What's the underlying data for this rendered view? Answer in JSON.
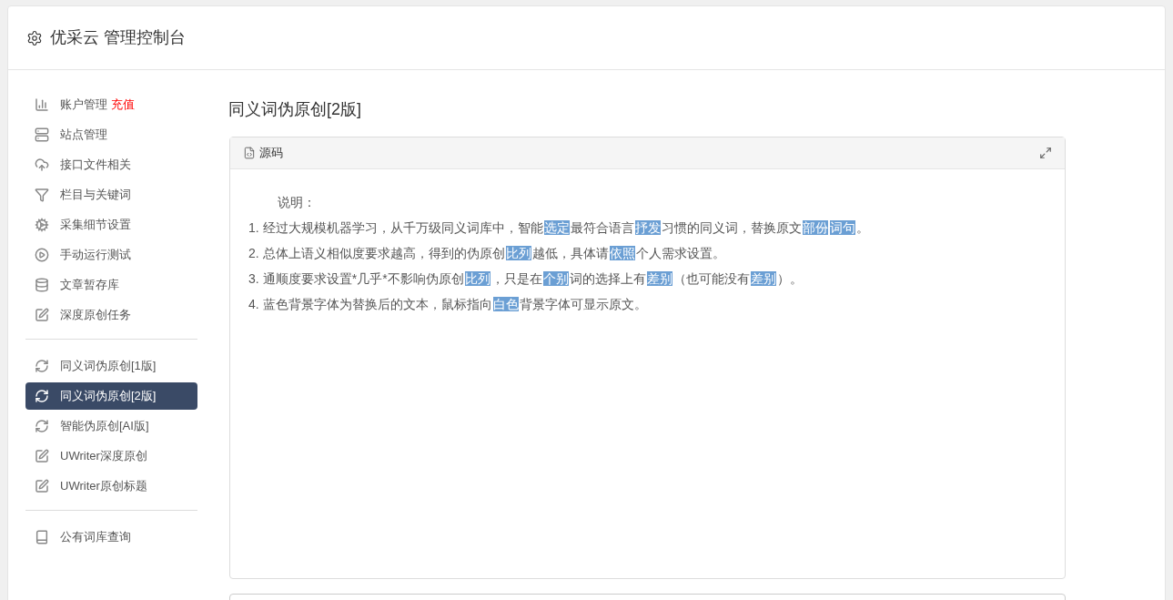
{
  "header": {
    "title": "优采云 管理控制台"
  },
  "sidebar": {
    "groups": [
      {
        "items": [
          {
            "label": "账户管理",
            "badge": "充值",
            "selected": false
          },
          {
            "label": "站点管理",
            "selected": false
          },
          {
            "label": "接口文件相关",
            "selected": false
          },
          {
            "label": "栏目与关键词",
            "selected": false
          },
          {
            "label": "采集细节设置",
            "selected": false
          },
          {
            "label": "手动运行测试",
            "selected": false
          },
          {
            "label": "文章暂存库",
            "selected": false
          },
          {
            "label": "深度原创任务",
            "selected": false
          }
        ]
      },
      {
        "items": [
          {
            "label": "同义词伪原创[1版]",
            "selected": false
          },
          {
            "label": "同义词伪原创[2版]",
            "selected": true
          },
          {
            "label": "智能伪原创[AI版]",
            "selected": false
          },
          {
            "label": "UWriter深度原创",
            "selected": false
          },
          {
            "label": "UWriter原创标题",
            "selected": false
          }
        ]
      },
      {
        "items": [
          {
            "label": "公有词库查询",
            "selected": false
          }
        ]
      }
    ]
  },
  "page": {
    "title": "同义词伪原创[2版]",
    "panel": {
      "tab": "源码",
      "heading": "说明：",
      "lines": [
        {
          "number": "1.",
          "segments": [
            {
              "text": "经过大规模机器学习，从千万级同义词库中，智能",
              "replaced": false
            },
            {
              "text": "选定",
              "replaced": true
            },
            {
              "text": "最符合语言",
              "replaced": false
            },
            {
              "text": "抒发",
              "replaced": true
            },
            {
              "text": "习惯的同义词，替换原文",
              "replaced": false
            },
            {
              "text": "部份",
              "replaced": true
            },
            {
              "text": "词句",
              "replaced": true
            },
            {
              "text": "。",
              "replaced": false
            }
          ]
        },
        {
          "number": "2.",
          "segments": [
            {
              "text": "总体上语义相似度要求越高，得到的伪原创",
              "replaced": false
            },
            {
              "text": "比列",
              "replaced": true
            },
            {
              "text": "越低，具体请",
              "replaced": false
            },
            {
              "text": "依照",
              "replaced": true
            },
            {
              "text": "个人需求设置。",
              "replaced": false
            }
          ]
        },
        {
          "number": "3.",
          "segments": [
            {
              "text": "通顺度要求设置*几乎*不影响伪原创",
              "replaced": false
            },
            {
              "text": "比列",
              "replaced": true
            },
            {
              "text": "，只是在",
              "replaced": false
            },
            {
              "text": "个别",
              "replaced": true
            },
            {
              "text": "词的选择上有",
              "replaced": false
            },
            {
              "text": "差别",
              "replaced": true
            },
            {
              "text": "（也可能没有",
              "replaced": false
            },
            {
              "text": "差别",
              "replaced": true
            },
            {
              "text": "）。",
              "replaced": false
            }
          ]
        },
        {
          "number": "4.",
          "segments": [
            {
              "text": "蓝色背景字体为替换后的文本，鼠标指向",
              "replaced": false
            },
            {
              "text": "白色",
              "replaced": true
            },
            {
              "text": "背景字体可显示原文。",
              "replaced": false
            }
          ]
        }
      ]
    }
  }
}
